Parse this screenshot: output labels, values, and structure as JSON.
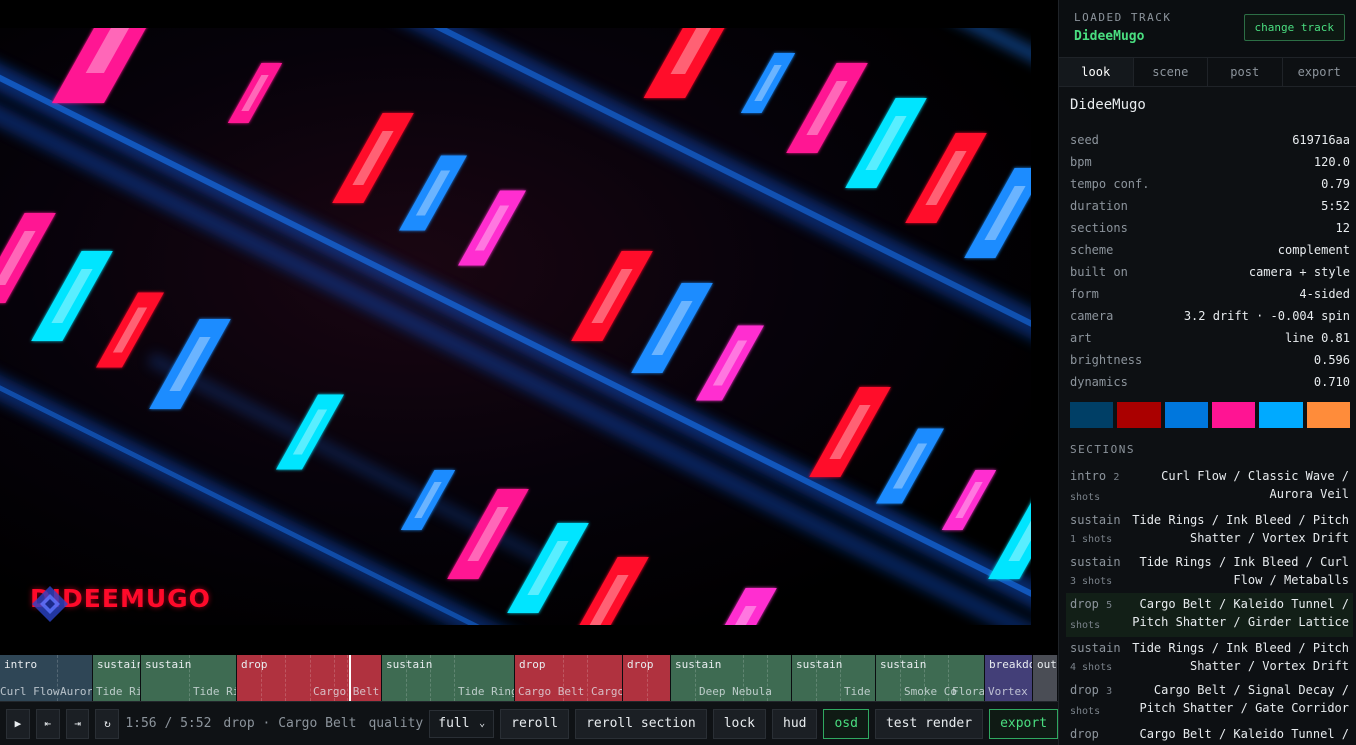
{
  "viewport": {
    "logo_text": "DIDEEMUGO",
    "palette": [
      "#ff1493",
      "#ff0a2a",
      "#00e5ff",
      "#1a8cff",
      "#ff2fd0"
    ]
  },
  "timeline": {
    "segments": [
      {
        "kind": "intro",
        "label": "intro",
        "subs": [
          "Curl Flow",
          "Aurora"
        ]
      },
      {
        "kind": "sustain",
        "label": "sustain",
        "subs": [
          "Tide Ri"
        ]
      },
      {
        "kind": "sustain",
        "label": "sustain",
        "subs": [
          "Tide Ri"
        ]
      },
      {
        "kind": "drop",
        "label": "drop",
        "subs": [
          "Cargo Belt"
        ]
      },
      {
        "kind": "sustain",
        "label": "sustain",
        "subs": [
          "Tide Ring"
        ]
      },
      {
        "kind": "drop",
        "label": "drop",
        "subs": [
          "Cargo Belt",
          "Cargo"
        ]
      },
      {
        "kind": "drop",
        "label": "drop",
        "subs": []
      },
      {
        "kind": "sustain",
        "label": "sustain",
        "subs": [
          "Deep Nebula"
        ]
      },
      {
        "kind": "sustain",
        "label": "sustain",
        "subs": [
          "Tide R"
        ]
      },
      {
        "kind": "sustain",
        "label": "sustain",
        "subs": [
          "Smoke Co",
          "Flora"
        ]
      },
      {
        "kind": "breakdown",
        "label": "breakdow",
        "subs": [
          "Vortex I"
        ]
      },
      {
        "kind": "outro",
        "label": "out",
        "subs": []
      }
    ],
    "playhead_fraction": 0.33
  },
  "transport": {
    "play_icon": "play-icon",
    "prev_icon": "skip-back-icon",
    "next_icon": "skip-forward-icon",
    "loop_icon": "loop-icon",
    "time": "1:56 / 5:52",
    "now_playing": "drop · Cargo Belt",
    "quality_label": "quality",
    "quality_value": "full",
    "reroll": "reroll",
    "reroll_section": "reroll section",
    "lock": "lock",
    "hud": "hud",
    "osd": "osd",
    "test_render": "test render",
    "export": "export"
  },
  "panel": {
    "loaded_label": "LOADED TRACK",
    "track_name": "DideeMugo",
    "change_track": "change track",
    "tabs": [
      "look",
      "scene",
      "post",
      "export"
    ],
    "title": "DideeMugo",
    "props": [
      {
        "k": "seed",
        "v": "619716aa"
      },
      {
        "k": "bpm",
        "v": "120.0"
      },
      {
        "k": "tempo conf.",
        "v": "0.79"
      },
      {
        "k": "duration",
        "v": "5:52"
      },
      {
        "k": "sections",
        "v": "12"
      },
      {
        "k": "scheme",
        "v": "complement"
      },
      {
        "k": "built on",
        "v": "camera + style"
      },
      {
        "k": "form",
        "v": "4-sided"
      },
      {
        "k": "camera",
        "v": "3.2 drift · -0.004 spin"
      },
      {
        "k": "art",
        "v": "line 0.81"
      },
      {
        "k": "brightness",
        "v": "0.596"
      },
      {
        "k": "dynamics",
        "v": "0.710"
      }
    ],
    "swatches": [
      "#003f66",
      "#aa0000",
      "#0077dd",
      "#ff1493",
      "#00aaff",
      "#ff8c3a"
    ],
    "sections_label": "SECTIONS",
    "sections": [
      {
        "kind": "intro",
        "shots": "2 shots",
        "desc": "Curl Flow / Classic Wave / Aurora Veil"
      },
      {
        "kind": "sustain",
        "shots": "1 shots",
        "desc": "Tide Rings / Ink Bleed / Pitch Shatter / Vortex Drift"
      },
      {
        "kind": "sustain",
        "shots": "3 shots",
        "desc": "Tide Rings / Ink Bleed / Curl Flow / Metaballs"
      },
      {
        "kind": "drop",
        "shots": "5 shots",
        "desc": "Cargo Belt / Kaleido Tunnel / Pitch Shatter / Girder Lattice",
        "active": true
      },
      {
        "kind": "sustain",
        "shots": "4 shots",
        "desc": "Tide Rings / Ink Bleed / Pitch Shatter / Vortex Drift"
      },
      {
        "kind": "drop",
        "shots": "3 shots",
        "desc": "Cargo Belt / Signal Decay / Pitch Shatter / Gate Corridor"
      },
      {
        "kind": "drop",
        "shots": "",
        "desc": "Cargo Belt / Kaleido Tunnel /"
      }
    ]
  }
}
